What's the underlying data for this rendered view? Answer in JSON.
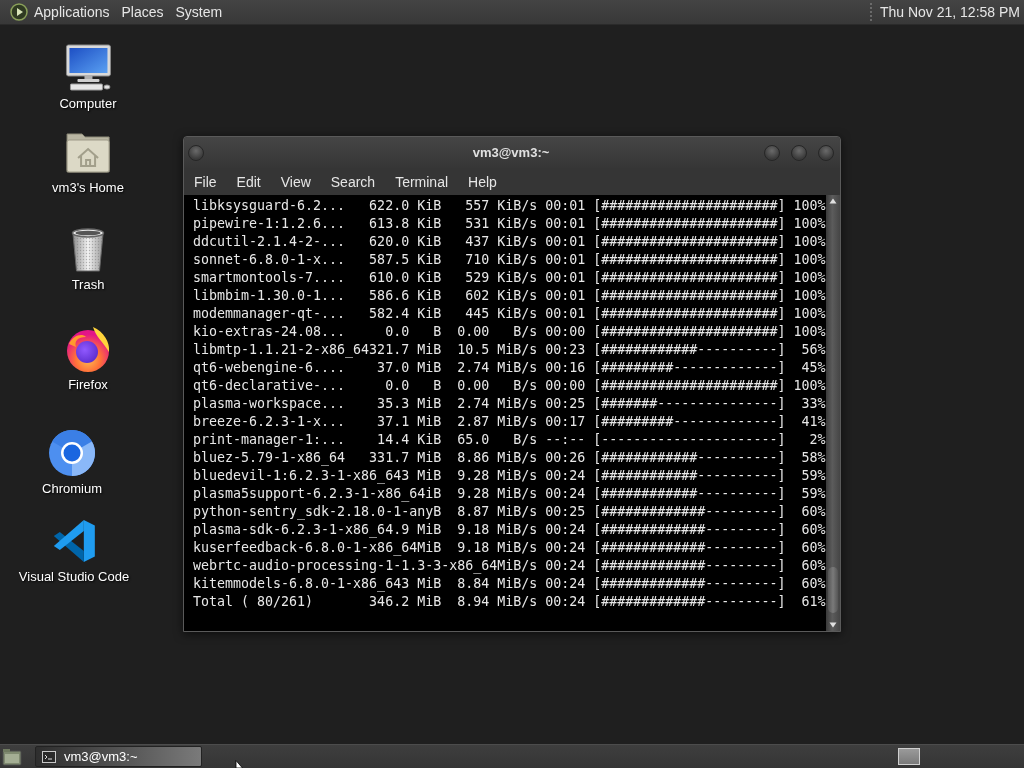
{
  "top_panel": {
    "menus": [
      "Applications",
      "Places",
      "System"
    ],
    "clock": "Thu Nov 21, 12:58 PM"
  },
  "desktop_icons": [
    {
      "label": "Computer",
      "kind": "computer"
    },
    {
      "label": "vm3's Home",
      "kind": "home_folder"
    },
    {
      "label": "Trash",
      "kind": "trash"
    },
    {
      "label": "Firefox",
      "kind": "firefox"
    },
    {
      "label": "Chromium",
      "kind": "chromium"
    },
    {
      "label": "Visual Studio Code",
      "kind": "vscode"
    }
  ],
  "terminal_window": {
    "title": "vm3@vm3:~",
    "menu": [
      "File",
      "Edit",
      "View",
      "Search",
      "Terminal",
      "Help"
    ],
    "lines": [
      "libksysguard-6.2...   622.0 KiB   557 KiB/s 00:01 [######################] 100%",
      "pipewire-1:1.2.6...   613.8 KiB   531 KiB/s 00:01 [######################] 100%",
      "ddcutil-2.1.4-2-...   620.0 KiB   437 KiB/s 00:01 [######################] 100%",
      "sonnet-6.8.0-1-x...   587.5 KiB   710 KiB/s 00:01 [######################] 100%",
      "smartmontools-7....   610.0 KiB   529 KiB/s 00:01 [######################] 100%",
      "libmbim-1.30.0-1...   586.6 KiB   602 KiB/s 00:01 [######################] 100%",
      "modemmanager-qt-...   582.4 KiB   445 KiB/s 00:01 [######################] 100%",
      "kio-extras-24.08...     0.0   B  0.00   B/s 00:00 [######################] 100%",
      "libmtp-1.1.21-2-x86_64321.7 MiB  10.5 MiB/s 00:23 [############----------]  56%",
      "qt6-webengine-6....    37.0 MiB  2.74 MiB/s 00:16 [#########-------------]  45%",
      "qt6-declarative-...     0.0   B  0.00   B/s 00:00 [######################] 100%",
      "plasma-workspace...    35.3 MiB  2.74 MiB/s 00:25 [#######---------------]  33%",
      "breeze-6.2.3-1-x...    37.1 MiB  2.87 MiB/s 00:17 [#########-------------]  41%",
      "print-manager-1:...    14.4 KiB  65.0   B/s --:-- [----------------------]   2%",
      "bluez-5.79-1-x86_64   331.7 MiB  8.86 MiB/s 00:26 [############----------]  58%",
      "bluedevil-1:6.2.3-1-x86_643 MiB  9.28 MiB/s 00:24 [############----------]  59%",
      "plasma5support-6.2.3-1-x86_64iB  9.28 MiB/s 00:24 [############----------]  59%",
      "python-sentry_sdk-2.18.0-1-anyB  8.87 MiB/s 00:25 [#############---------]  60%",
      "plasma-sdk-6.2.3-1-x86_64.9 MiB  9.18 MiB/s 00:24 [#############---------]  60%",
      "kuserfeedback-6.8.0-1-x86_64MiB  9.18 MiB/s 00:24 [#############---------]  60%",
      "webrtc-audio-processing-1-1.3-3-x86_64MiB/s 00:24 [#############---------]  60%",
      "kitemmodels-6.8.0-1-x86_643 MiB  8.84 MiB/s 00:24 [#############---------]  60%",
      "Total ( 80/261)       346.2 MiB  8.94 MiB/s 00:24 [#############---------]  61%"
    ]
  },
  "taskbar": {
    "tasks": [
      {
        "label": "vm3@vm3:~",
        "selected": true
      }
    ]
  }
}
